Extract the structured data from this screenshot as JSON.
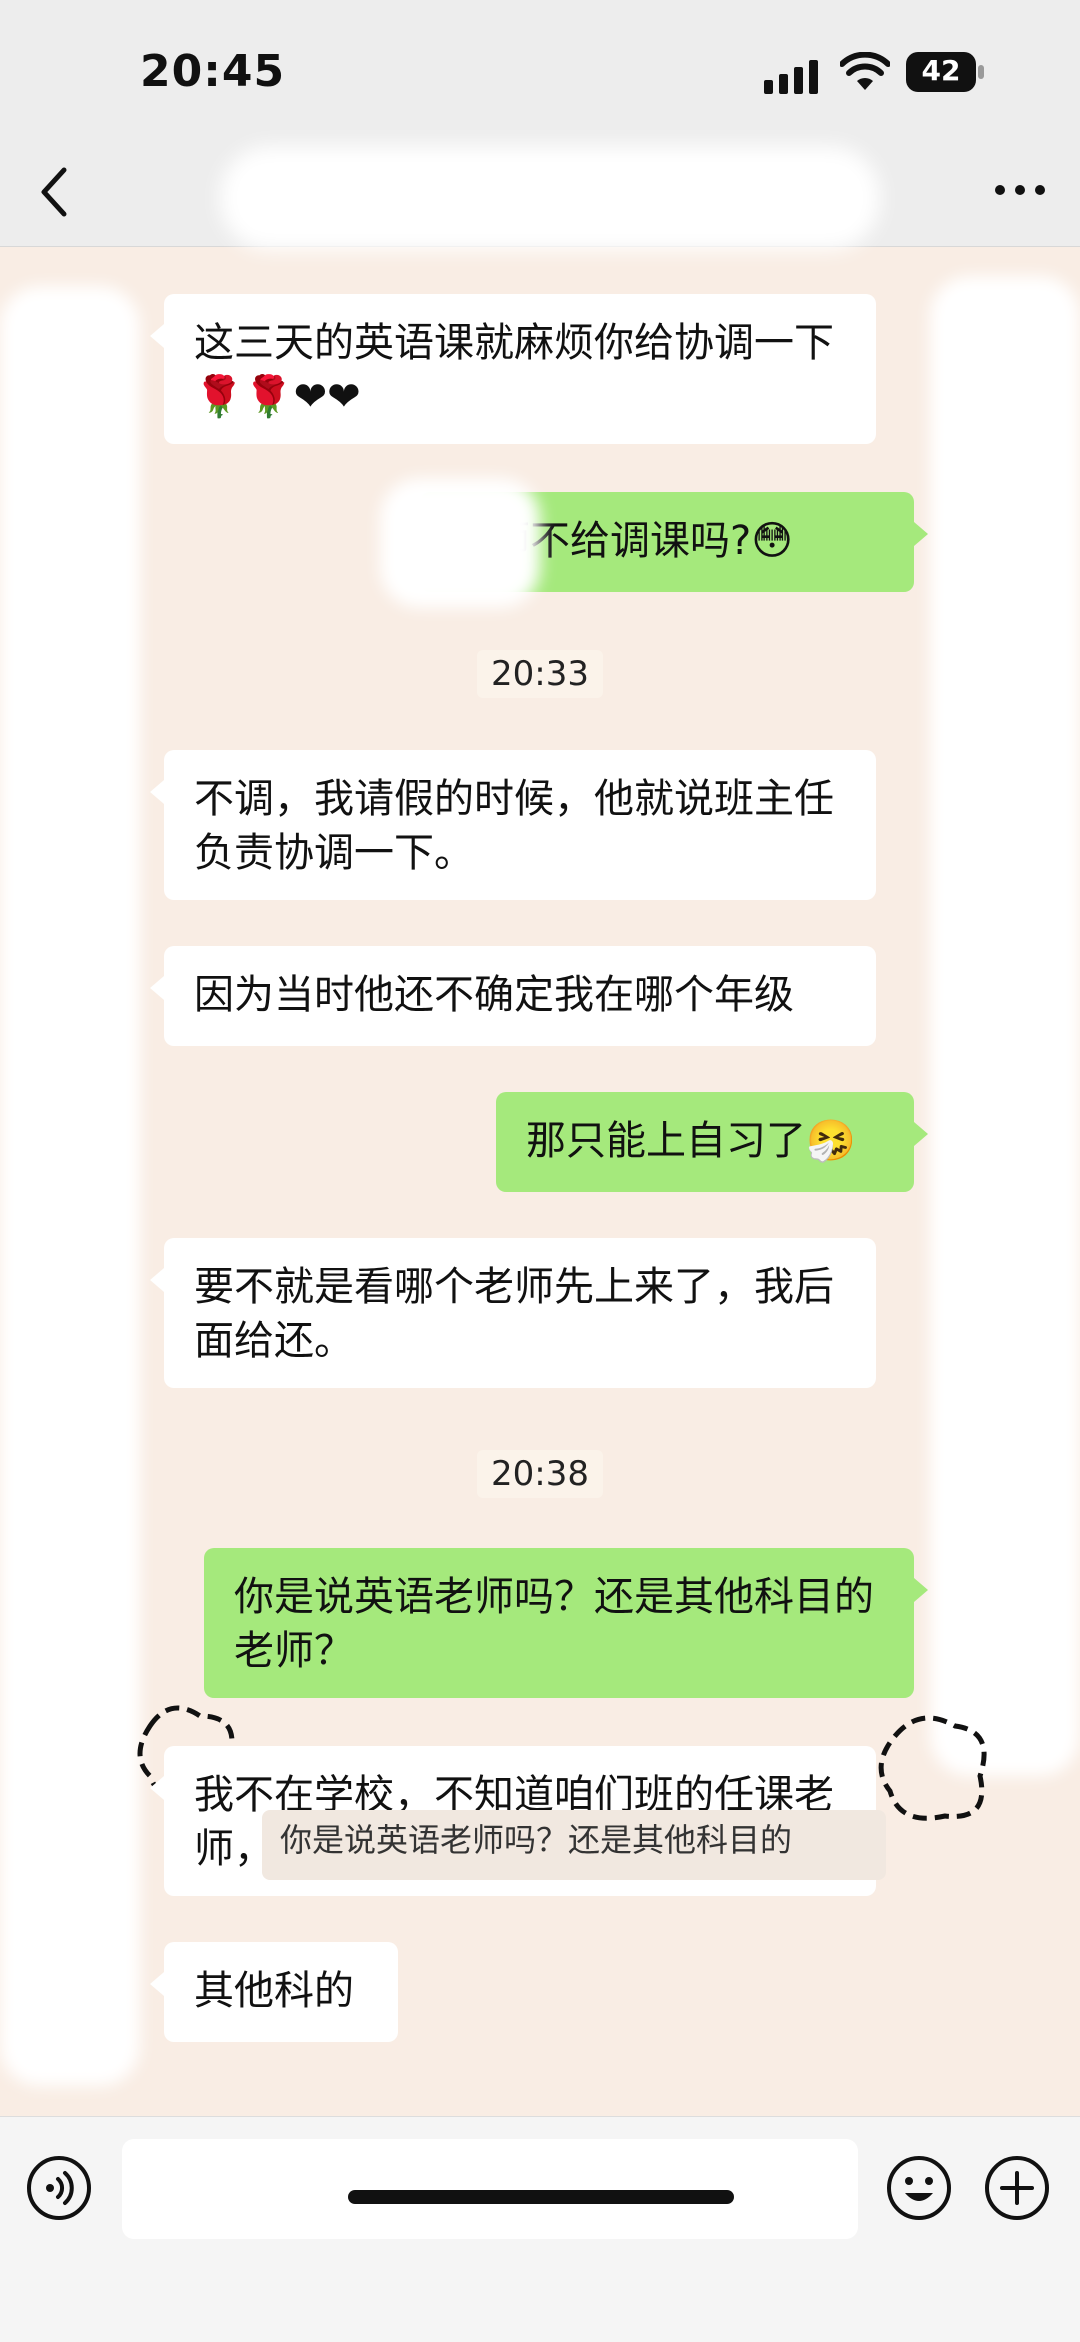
{
  "status_bar": {
    "time": "20:45",
    "battery": "42"
  },
  "header": {
    "title": ""
  },
  "messages": [
    {
      "side": "left",
      "text": "这三天的英语课就麻烦你给协调一下🌹🌹❤❤"
    },
    {
      "side": "right",
      "text": "老师不给调课吗?😳"
    },
    {
      "type": "timestamp",
      "text": "20:33"
    },
    {
      "side": "left",
      "text": "不调，我请假的时候，他就说班主任负责协调一下。"
    },
    {
      "side": "left",
      "text": "因为当时他还不确定我在哪个年级"
    },
    {
      "side": "right",
      "text": "那只能上自习了🤧"
    },
    {
      "side": "left",
      "text": "要不就是看哪个老师先上来了，我后面给还。"
    },
    {
      "type": "timestamp",
      "text": "20:38"
    },
    {
      "side": "right",
      "text": "你是说英语老师吗？还是其他科目的老师？"
    },
    {
      "side": "left",
      "text": "我不在学校，不知道咱们班的任课老师，不好弄。"
    },
    {
      "side": "left",
      "text": "其他科的"
    }
  ],
  "quote": {
    "text": "你是说英语老师吗？还是其他科目的"
  },
  "icons": {
    "back": "chevron-left-icon",
    "more": "ellipsis-icon",
    "voice": "voice-icon",
    "emoji": "smile-icon",
    "add": "plus-icon"
  }
}
